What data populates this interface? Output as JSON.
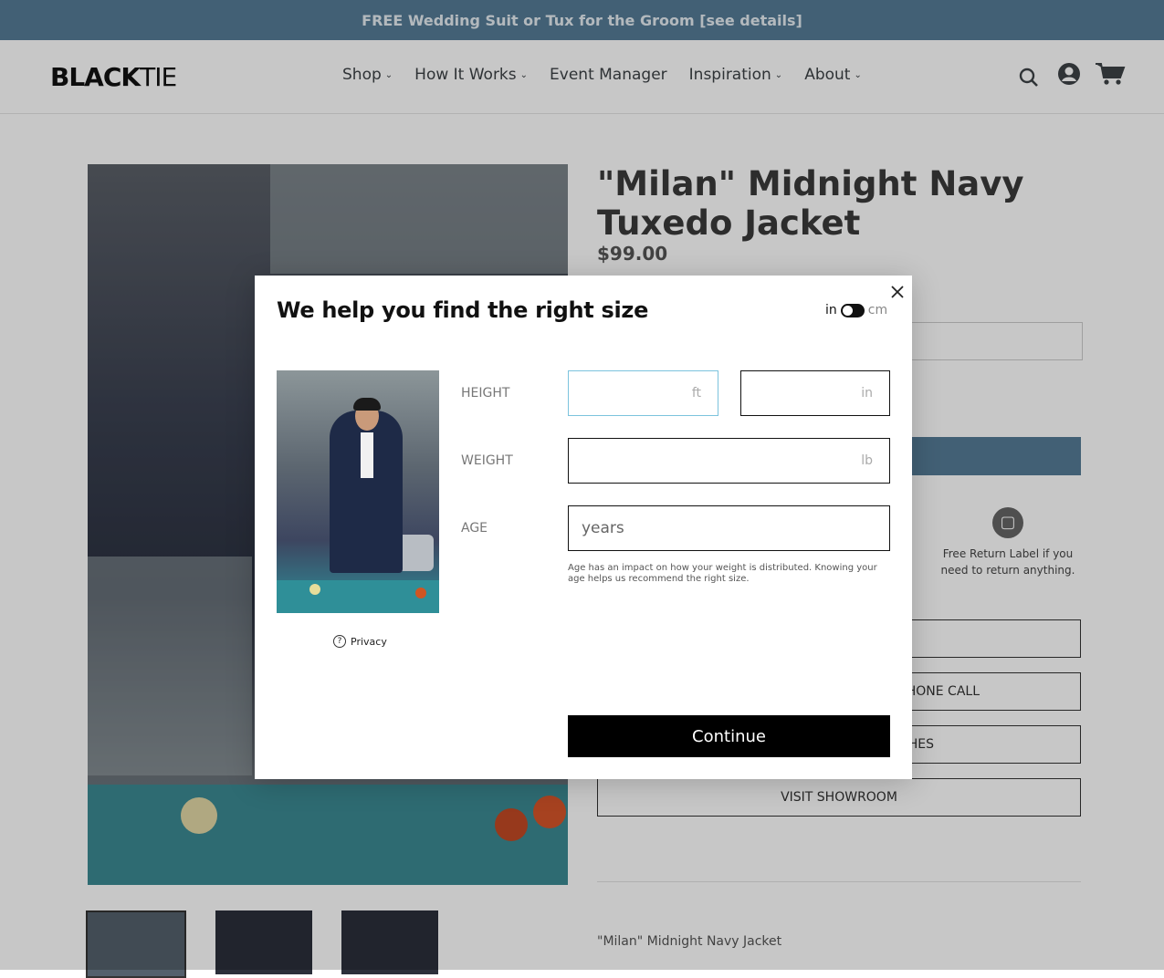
{
  "announcement": {
    "text": "FREE Wedding Suit or Tux for the Groom [see details]"
  },
  "header": {
    "logo_bold": "BLACK",
    "logo_thin": "TIE",
    "nav": [
      {
        "label": "Shop",
        "dropdown": true
      },
      {
        "label": "How It Works",
        "dropdown": true
      },
      {
        "label": "Event Manager",
        "dropdown": false
      },
      {
        "label": "Inspiration",
        "dropdown": true
      },
      {
        "label": "About",
        "dropdown": true
      }
    ],
    "icons": [
      "search-icon",
      "account-icon",
      "cart-icon"
    ]
  },
  "product": {
    "title": "\"Milan\" Midnight Navy Tuxedo Jacket",
    "price": "$99.00",
    "return_label": "Free Return Label if you need to return anything.",
    "button_phone_call": "PHONE CALL",
    "button_swatches_partial": "HES",
    "button_visit_showroom": "VISIT SHOWROOM",
    "description": "\"Milan\" Midnight Navy Jacket"
  },
  "modal": {
    "title": "We help you find the right size",
    "unit_toggle": {
      "left": "in",
      "right": "cm",
      "selected": "in"
    },
    "height_label": "HEIGHT",
    "height_ft_unit": "ft",
    "height_in_unit": "in",
    "weight_label": "WEIGHT",
    "weight_unit": "lb",
    "age_label": "AGE",
    "age_placeholder": "years",
    "age_note": "Age has an impact on how your weight is distributed. Knowing your age helps us recommend the right size.",
    "privacy_label": "Privacy",
    "continue_label": "Continue"
  },
  "colors": {
    "announcement_bg": "#557b97",
    "button_primary": "#000000",
    "focus_border": "#7cc3dd"
  }
}
